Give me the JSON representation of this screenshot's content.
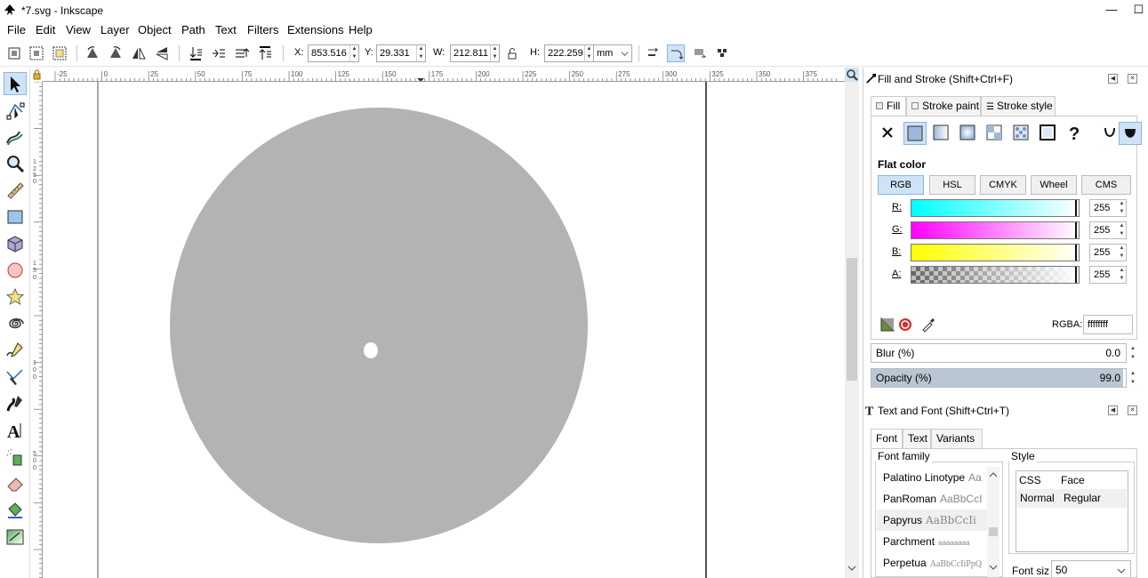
{
  "window": {
    "title": "*7.svg - Inkscape",
    "minimize": "—",
    "maximize": "☐"
  },
  "menu": [
    {
      "label": "File"
    },
    {
      "label": "Edit"
    },
    {
      "label": "View"
    },
    {
      "label": "Layer"
    },
    {
      "label": "Object"
    },
    {
      "label": "Path"
    },
    {
      "label": "Text"
    },
    {
      "label": "Filters"
    },
    {
      "label": "Extensions"
    },
    {
      "label": "Help"
    }
  ],
  "controls": {
    "x_label": "X:",
    "x_value": "853.516",
    "y_label": "Y:",
    "y_value": "29.331",
    "w_label": "W:",
    "w_value": "212.811",
    "h_label": "H:",
    "h_value": "222.259",
    "unit": "mm"
  },
  "rulers": {
    "h_ticks": [
      "-25",
      "0",
      "25",
      "50",
      "75",
      "100",
      "125",
      "150",
      "175",
      "200",
      "225",
      "250",
      "275",
      "300",
      "325",
      "350",
      "375"
    ],
    "v_ticks": [
      "1",
      "2",
      "5",
      "0",
      "1",
      "5",
      "0",
      "1",
      "0",
      "0",
      "5",
      "0",
      "0"
    ]
  },
  "colors": {
    "circle_fill": "#b3b3b3",
    "accent": "#cfe3f7",
    "canvas_border": "#555555"
  },
  "fill_stroke": {
    "title": "Fill and Stroke (Shift+Ctrl+F)",
    "tabs": [
      {
        "label": "Fill",
        "ul": "F"
      },
      {
        "label": "Stroke paint"
      },
      {
        "label": "Stroke style"
      }
    ],
    "section_title": "Flat color",
    "modes": [
      "RGB",
      "HSL",
      "CMYK",
      "Wheel",
      "CMS"
    ],
    "channels": [
      {
        "label": "R:",
        "value": "255"
      },
      {
        "label": "G:",
        "value": "255"
      },
      {
        "label": "B:",
        "value": "255"
      },
      {
        "label": "A:",
        "value": "255"
      }
    ],
    "rgba_label": "RGBA:",
    "rgba_value": "ffffffff",
    "blur_label": "Blur (%)",
    "blur_value": "0.0",
    "opacity_label": "Opacity (%)",
    "opacity_value": "99.0",
    "opacity_level": 99
  },
  "text_font": {
    "title": "Text and Font (Shift+Ctrl+T)",
    "tabs": [
      "Font",
      "Text",
      "Variants"
    ],
    "family_label": "Font family",
    "style_label": "Style",
    "fonts": [
      {
        "name": "Palatino Linotype",
        "sample": "Aa"
      },
      {
        "name": "PanRoman",
        "sample": "AaBbCcI"
      },
      {
        "name": "Papyrus",
        "sample": "AaBbCcIi"
      },
      {
        "name": "Parchment",
        "sample": "aaaaaaaa"
      },
      {
        "name": "Perpetua",
        "sample": "AaBbCcIiPpQ"
      }
    ],
    "style_headers": [
      "CSS",
      "Face"
    ],
    "style_row": {
      "css": "Normal",
      "face": "Regular"
    },
    "size_label": "Font siz",
    "size_value": "50"
  }
}
